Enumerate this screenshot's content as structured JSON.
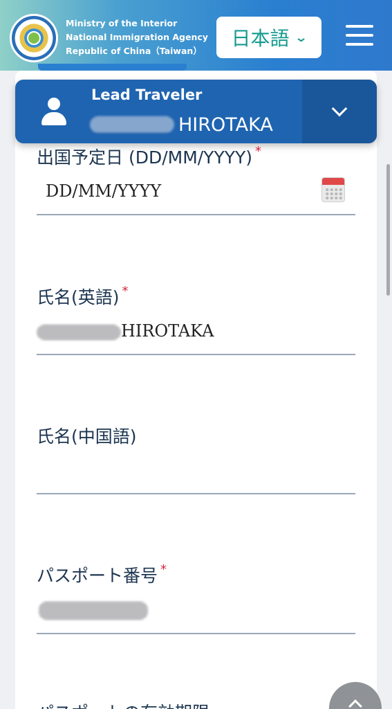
{
  "header": {
    "agency_lines": [
      "Ministry of the Interior",
      "National Immigration Agency",
      "Republic of China（Taiwan）"
    ],
    "language_selected": "日本語",
    "language_icon": "chevron-down-icon",
    "menu_icon": "hamburger-menu-icon"
  },
  "lead_traveler": {
    "title": "Lead Traveler",
    "name_visible": "HIROTAKA",
    "expand_icon": "chevron-down-icon"
  },
  "form": {
    "departure_date": {
      "label": "出国予定日 (DD/MM/YYYY)",
      "required_mark": "*",
      "placeholder": "DD/MM/YYYY",
      "icon": "calendar-icon"
    },
    "name_english": {
      "label": "氏名(英語)",
      "required_mark": "*",
      "value_visible": "HIROTAKA"
    },
    "name_chinese": {
      "label": "氏名(中国語)",
      "value": ""
    },
    "passport_number": {
      "label": "パスポート番号",
      "required_mark": "*"
    },
    "passport_expiry": {
      "label": "パスポートの有効期限"
    }
  },
  "colors": {
    "primary": "#1f64b0",
    "accent": "#159a8f",
    "required": "#d9223b"
  }
}
